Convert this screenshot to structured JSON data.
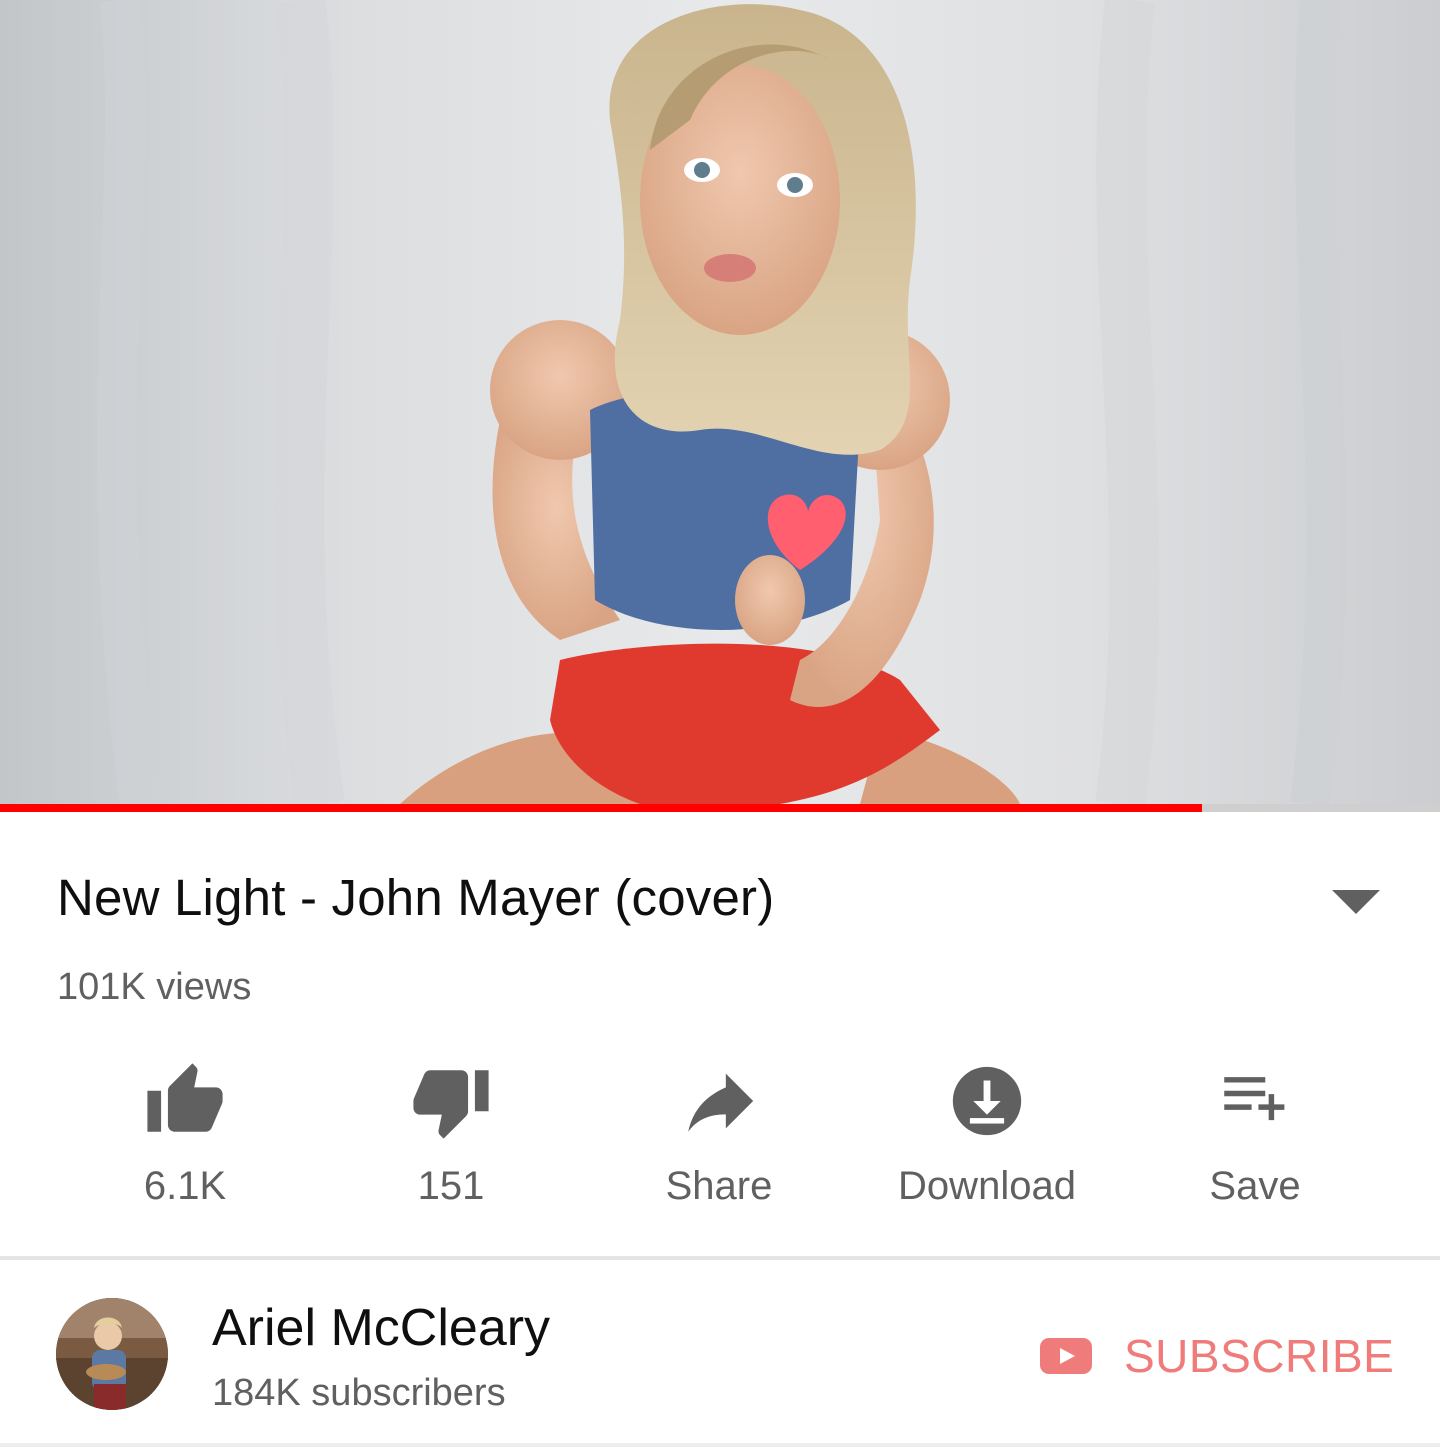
{
  "video": {
    "progress_percent": 83.5
  },
  "info": {
    "title": "New Light - John Mayer (cover)",
    "views": "101K views"
  },
  "actions": [
    {
      "icon": "thumbs-up-icon",
      "label": "6.1K"
    },
    {
      "icon": "thumbs-down-icon",
      "label": "151"
    },
    {
      "icon": "share-icon",
      "label": "Share"
    },
    {
      "icon": "download-icon",
      "label": "Download"
    },
    {
      "icon": "save-playlist-icon",
      "label": "Save"
    }
  ],
  "channel": {
    "name": "Ariel McCleary",
    "subscribers": "184K subscribers",
    "subscribe_label": "SUBSCRIBE"
  },
  "colors": {
    "accent": "#ff0000",
    "subscribe_text": "#f07b7b",
    "icon_gray": "#606060"
  }
}
